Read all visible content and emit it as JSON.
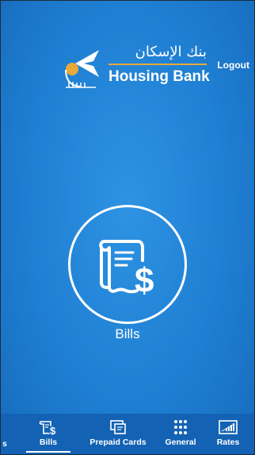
{
  "header": {
    "logo": {
      "arabic_text": "بنك الإسكان",
      "english_text": "Housing Bank",
      "brand_colors": {
        "accent": "#e9a93a",
        "text": "#ffffff"
      }
    },
    "logout_label": "Logout"
  },
  "main": {
    "feature": {
      "icon": "bill-dollar-icon",
      "label": "Bills"
    }
  },
  "tabbar": {
    "partial_label": "s",
    "tabs": [
      {
        "label": "Bills",
        "icon": "bill-dollar-icon",
        "active": true
      },
      {
        "label": "Prepaid Cards",
        "icon": "prepaid-card-icon",
        "active": false
      },
      {
        "label": "General",
        "icon": "grid-dots-icon",
        "active": false
      },
      {
        "label": "Rates",
        "icon": "rates-chart-icon",
        "active": false
      }
    ]
  },
  "colors": {
    "background": "#1f7fd2",
    "tabbar": "#1362b4",
    "foreground": "#ffffff"
  }
}
